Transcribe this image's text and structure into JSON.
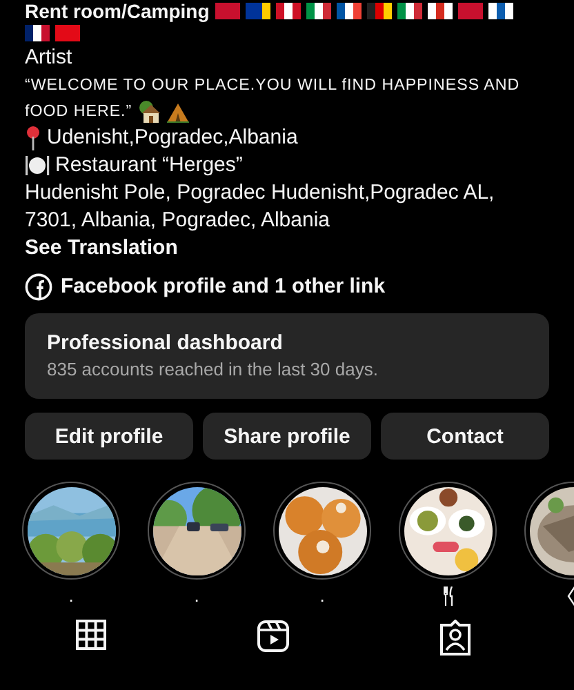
{
  "bio": {
    "title": "Rent room/Camping",
    "category": "Artist",
    "quote_lines": [
      "“WELCOME TO OUR PLACE.YOU WILL fIND HAPPINESS AND",
      "fOOD HERE.”"
    ],
    "location": "Udenisht,Pogradec,Albania",
    "restaurant": "Restaurant “Herges”",
    "address": "Hudenisht Pole, Pogradec Hudenisht,Pogradec AL, 7301, Albania, Pogradec, Albania",
    "see_translation": "See Translation",
    "links": "Facebook profile and 1 other link"
  },
  "dashboard": {
    "title": "Professional dashboard",
    "subtitle": "835 accounts reached in the last 30 days."
  },
  "buttons": [
    "Edit profile",
    "Share profile",
    "Contact"
  ],
  "highlights": [
    {
      "kind": "text",
      "label": "."
    },
    {
      "kind": "text",
      "label": "."
    },
    {
      "kind": "text",
      "label": "."
    },
    {
      "kind": "cutlery"
    },
    {
      "kind": "partial"
    }
  ],
  "tabs": [
    {
      "kind": "grid"
    },
    {
      "kind": "reels"
    },
    {
      "kind": "tagged"
    }
  ]
}
